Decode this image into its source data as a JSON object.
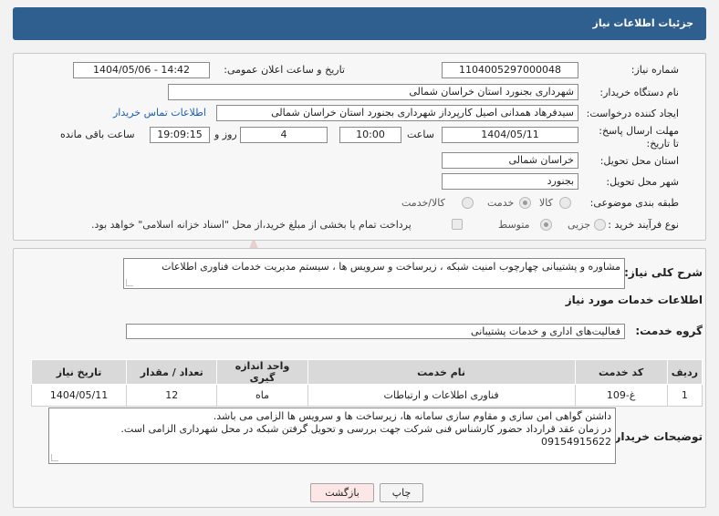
{
  "header": {
    "title": "جزئیات اطلاعات نیاز"
  },
  "form": {
    "need_number_label": "شماره نیاز:",
    "need_number": "1104005297000048",
    "announce_label": "تاریخ و ساعت اعلان عمومی:",
    "announce_value": "1404/05/06 - 14:42",
    "buyer_org_label": "نام دستگاه خریدار:",
    "buyer_org": "شهرداری بجنورد استان خراسان شمالی",
    "creator_label": "ایجاد کننده درخواست:",
    "creator": "سیدفرهاد همدانی اصیل کارپرداز شهرداری بجنورد استان خراسان شمالی",
    "contact_link": "اطلاعات تماس خریدار",
    "deadline_label": "مهلت ارسال پاسخ: تا تاریخ:",
    "deadline_date": "1404/05/11",
    "time_label": "ساعت",
    "deadline_time": "10:00",
    "days_value": "4",
    "days_label": "روز و",
    "remaining_time": "19:09:15",
    "remaining_label": "ساعت باقی مانده",
    "province_label": "استان محل تحویل:",
    "province": "خراسان شمالی",
    "city_label": "شهر محل تحویل:",
    "city": "بجنورد",
    "category_label": "طبقه بندی موضوعی:",
    "category_options": [
      "کالا",
      "خدمت",
      "کالا/خدمت"
    ],
    "category_selected": "خدمت",
    "process_label": "نوع فرآیند خرید :",
    "process_options": [
      "جزیی",
      "متوسط"
    ],
    "process_selected": "متوسط",
    "payment_note": "پرداخت تمام یا بخشی از مبلغ خرید،از محل \"اسناد خزانه اسلامی\" خواهد بود."
  },
  "summary": {
    "label": "شرح کلی نیاز:",
    "text": "مشاوره و پشتیبانی چهارچوب امنیت شبکه ، زیرساخت و سرویس ها ، سیستم مدیریت خدمات فناوری اطلاعات"
  },
  "services": {
    "title": "اطلاعات خدمات مورد نیاز",
    "group_label": "گروه خدمت:",
    "group_value": "فعالیت‌های اداری و خدمات پشتیبانی",
    "columns": [
      "ردیف",
      "کد خدمت",
      "نام خدمت",
      "واحد اندازه گیری",
      "تعداد / مقدار",
      "تاریخ نیاز"
    ],
    "rows": [
      [
        "1",
        "غ-109",
        "فناوری اطلاعات و ارتباطات",
        "ماه",
        "12",
        "1404/05/11"
      ]
    ]
  },
  "buyer_notes": {
    "label": "توضیحات خریدار:",
    "lines": [
      "داشتن گواهی امن سازی و مقاوم سازی سامانه ها، زیرساخت ها و سرویس ها الزامی می باشد.",
      "در زمان عقد قرارداد حضور کارشناس فنی شرکت جهت بررسی و تحویل گرفتن شبکه در محل شهرداری الزامی است.",
      "09154915622"
    ]
  },
  "buttons": {
    "print": "چاپ",
    "back": "بازگشت"
  },
  "watermark": {
    "text": "AriaTender.neT"
  },
  "colors": {
    "header": "#2e5f8e",
    "link": "#1a5fb4",
    "watermark": "#e6b0b0"
  }
}
